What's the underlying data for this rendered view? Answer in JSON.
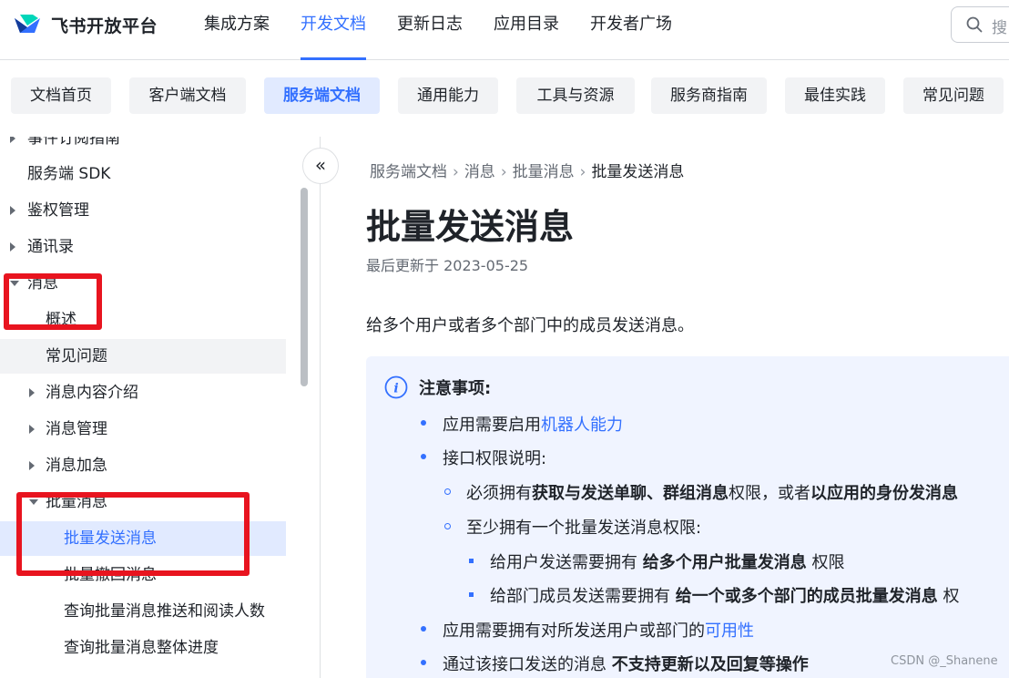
{
  "header": {
    "brand": "飞书开放平台",
    "nav": [
      {
        "label": "集成方案",
        "active": false
      },
      {
        "label": "开发文档",
        "active": true
      },
      {
        "label": "更新日志",
        "active": false
      },
      {
        "label": "应用目录",
        "active": false
      },
      {
        "label": "开发者广场",
        "active": false
      }
    ],
    "search_text": "搜"
  },
  "tabs": [
    {
      "label": "文档首页",
      "active": false
    },
    {
      "label": "客户端文档",
      "active": false
    },
    {
      "label": "服务端文档",
      "active": true
    },
    {
      "label": "通用能力",
      "active": false
    },
    {
      "label": "工具与资源",
      "active": false
    },
    {
      "label": "服务商指南",
      "active": false
    },
    {
      "label": "最佳实践",
      "active": false
    },
    {
      "label": "常见问题",
      "active": false
    }
  ],
  "sidebar": {
    "items": [
      {
        "label": "事件订阅指南",
        "caret": "right"
      },
      {
        "label": "服务端 SDK",
        "caret": ""
      },
      {
        "label": "鉴权管理",
        "caret": "right"
      },
      {
        "label": "通讯录",
        "caret": "right"
      },
      {
        "label": "消息",
        "caret": "down"
      },
      {
        "label": "概述",
        "caret": ""
      },
      {
        "label": "常见问题",
        "caret": ""
      },
      {
        "label": "消息内容介绍",
        "caret": "right"
      },
      {
        "label": "消息管理",
        "caret": "right"
      },
      {
        "label": "消息加急",
        "caret": "right"
      },
      {
        "label": "批量消息",
        "caret": "down"
      },
      {
        "label": "批量发送消息",
        "caret": ""
      },
      {
        "label": "批量撤回消息",
        "caret": ""
      },
      {
        "label": "查询批量消息推送和阅读人数",
        "caret": ""
      },
      {
        "label": "查询批量消息整体进度",
        "caret": ""
      }
    ],
    "collapse_glyph": "«"
  },
  "breadcrumb": [
    "服务端文档",
    "消息",
    "批量消息",
    "批量发送消息"
  ],
  "breadcrumb_sep": "›",
  "page": {
    "title": "批量发送消息",
    "updated": "最后更新于 2023-05-25",
    "intro": "给多个用户或者多个部门中的成员发送消息。"
  },
  "note": {
    "icon_glyph": "i",
    "heading": "注意事项:",
    "l1_pre": "应用需要启用",
    "l1_link": "机器人能力",
    "l2": "接口权限说明:",
    "l3_pre": "必须拥有",
    "l3_b1": "获取与发送单聊、群组消息",
    "l3_mid": "权限，或者",
    "l3_b2": "以应用的身份发消息",
    "l4": "至少拥有一个批量发送消息权限:",
    "l5_pre": "给用户发送需要拥有",
    "l5_b": "给多个用户批量发消息",
    "l5_post": "权限",
    "l6_pre": "给部门成员发送需要拥有",
    "l6_b": "给一个或多个部门的成员批量发消息",
    "l6_post": "权",
    "l7_pre": "应用需要拥有对所发送用户或部门的",
    "l7_link": "可用性",
    "l8_pre": "通过该接口发送的消息",
    "l8_b": "不支持更新以及回复等操作"
  },
  "watermark": "CSDN @_Shanene",
  "colors": {
    "accent": "#3370ff",
    "annotation": "#e8141f",
    "note_bg": "#f0f4ff"
  }
}
